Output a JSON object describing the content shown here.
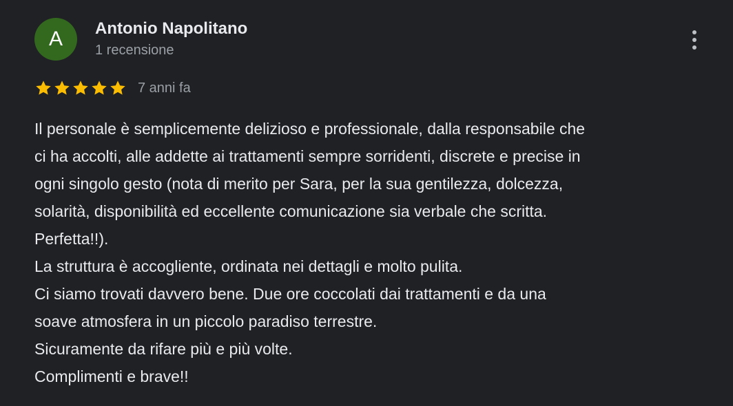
{
  "author": {
    "initial": "A",
    "name": "Antonio Napolitano",
    "meta": "1 recensione",
    "avatar_color": "#33691e"
  },
  "rating": {
    "stars": 5,
    "max": 5,
    "star_color": "#fbbc04",
    "date": "7 anni fa"
  },
  "menu": {
    "icon": "more-vert-icon"
  },
  "review": {
    "lines": [
      "Il personale è semplicemente delizioso e professionale, dalla responsabile che",
      "ci ha accolti, alle addette ai trattamenti sempre sorridenti, discrete e precise in",
      "ogni singolo gesto (nota di merito per Sara, per la sua gentilezza, dolcezza,",
      "solarità, disponibilità ed eccellente comunicazione sia verbale che scritta.",
      "Perfetta!!).",
      "La struttura è accogliente, ordinata nei dettagli e molto pulita.",
      "Ci siamo trovati davvero bene. Due ore coccolati dai trattamenti e da una",
      "soave atmosfera in un piccolo paradiso terrestre.",
      "Sicuramente da rifare più e più volte.",
      "Complimenti e brave!!"
    ]
  }
}
